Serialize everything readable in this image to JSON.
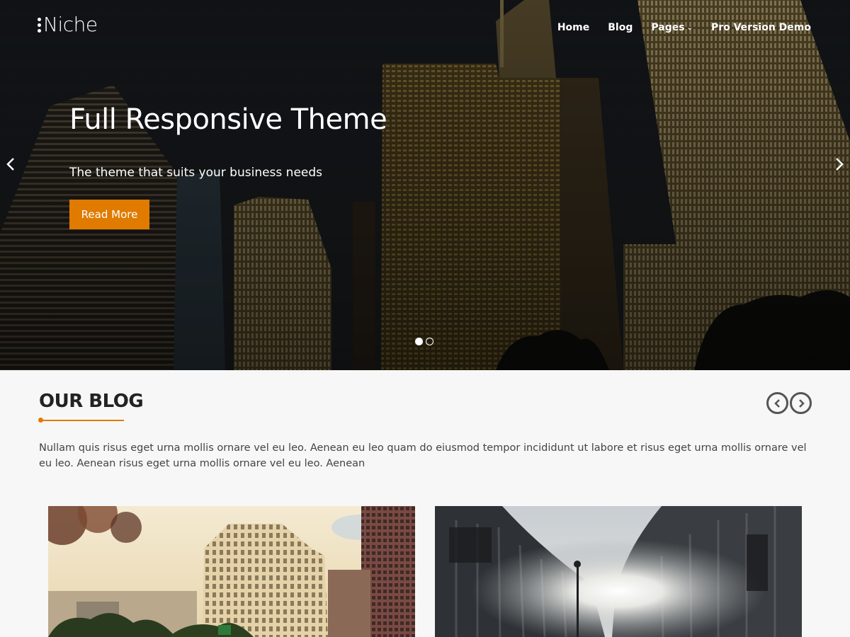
{
  "header": {
    "logo_text": "Niche",
    "nav": [
      {
        "label": "Home"
      },
      {
        "label": "Blog"
      },
      {
        "label": "Pages",
        "has_dropdown": true
      },
      {
        "label": "Pro Version Demo"
      }
    ]
  },
  "hero": {
    "title": "Full Responsive Theme",
    "subtitle": "The theme that suits your business needs",
    "button_label": "Read More",
    "slide_count": 2,
    "active_slide": 1
  },
  "blog": {
    "heading": "OUR BLOG",
    "description": "Nullam quis risus eget urna mollis ornare vel eu leo. Aenean eu leo quam do eiusmod tempor incididunt ut labore et risus eget urna mollis ornare vel eu leo. Aenean risus eget urna mollis ornare vel eu leo. Aenean"
  },
  "icons": {
    "slider_prev": "chevron-left-icon",
    "slider_next": "chevron-right-icon",
    "blog_prev": "circle-chevron-left-icon",
    "blog_next": "circle-chevron-right-icon",
    "dropdown": "chevron-down-icon"
  },
  "colors": {
    "accent": "#e07b00",
    "text_dark": "#222222",
    "background": "#f7f7f7"
  }
}
